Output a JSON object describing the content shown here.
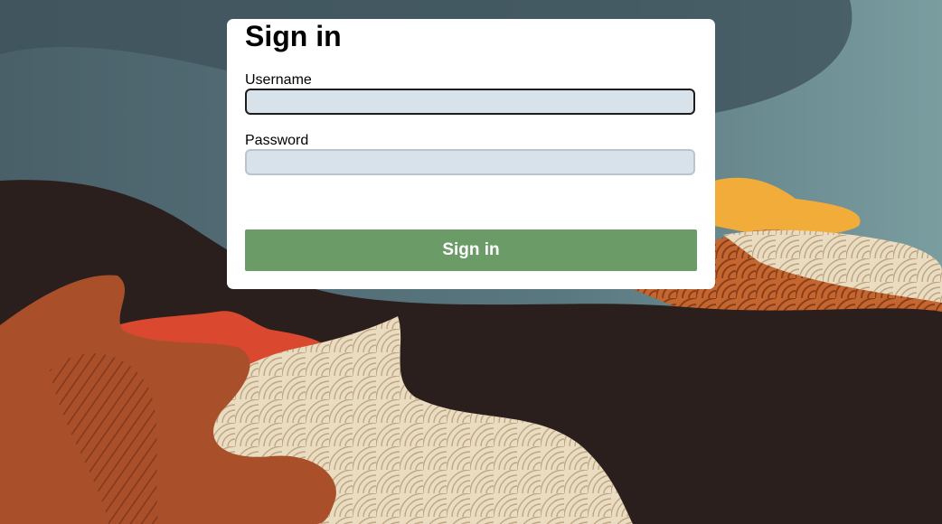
{
  "page": {
    "title": "Sign in"
  },
  "form": {
    "username_label": "Username",
    "username_value": "",
    "password_label": "Password",
    "password_value": "",
    "submit_label": "Sign in"
  },
  "colors": {
    "submit_button": "#6b9c67",
    "input_background": "#d7e2ea",
    "card_background": "#ffffff",
    "sky": "#4f6b73",
    "dark_hill": "#2a1f1d",
    "rust_hill": "#a9502a",
    "cream_hill": "#e9dcc0",
    "orange_accent": "#f2ac3a",
    "red_accent": "#d9482f"
  }
}
